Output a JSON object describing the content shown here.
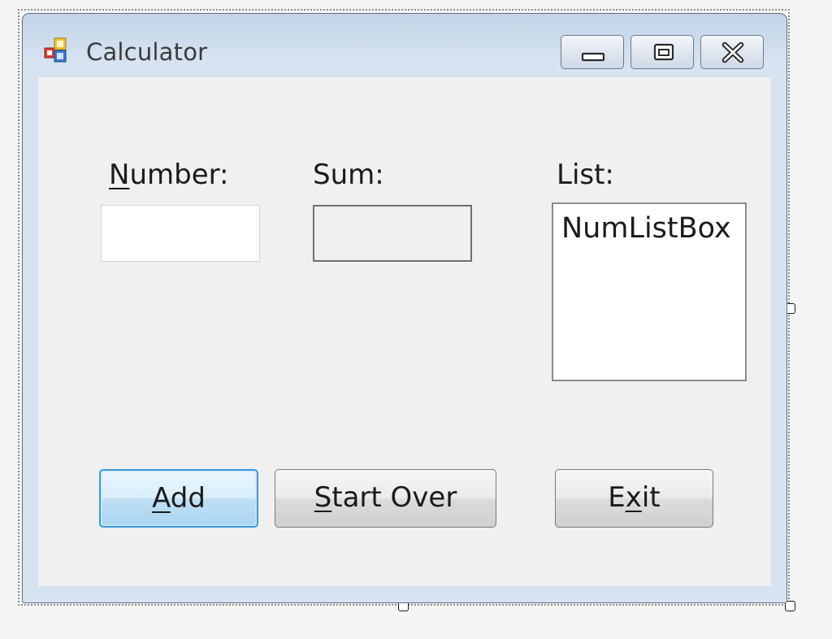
{
  "window": {
    "title": "Calculator"
  },
  "labels": {
    "number_prefix": "N",
    "number_rest": "umber:",
    "sum": "Sum:",
    "list": "List:"
  },
  "inputs": {
    "number_value": "",
    "sum_value": ""
  },
  "listbox": {
    "items": [
      "NumListBox"
    ]
  },
  "buttons": {
    "add_mnemonic": "A",
    "add_rest": "dd",
    "start_mnemonic": "S",
    "start_rest": "tart Over",
    "exit_pre": "E",
    "exit_mnemonic": "x",
    "exit_post": "it"
  },
  "icons": {
    "app": "form-icon",
    "minimize": "minimize-icon",
    "maximize": "maximize-icon",
    "close": "close-icon"
  },
  "colors": {
    "title_bar": "#c3d4e7",
    "client": "#f0f0f0",
    "focus_border": "#3a9bd8"
  }
}
